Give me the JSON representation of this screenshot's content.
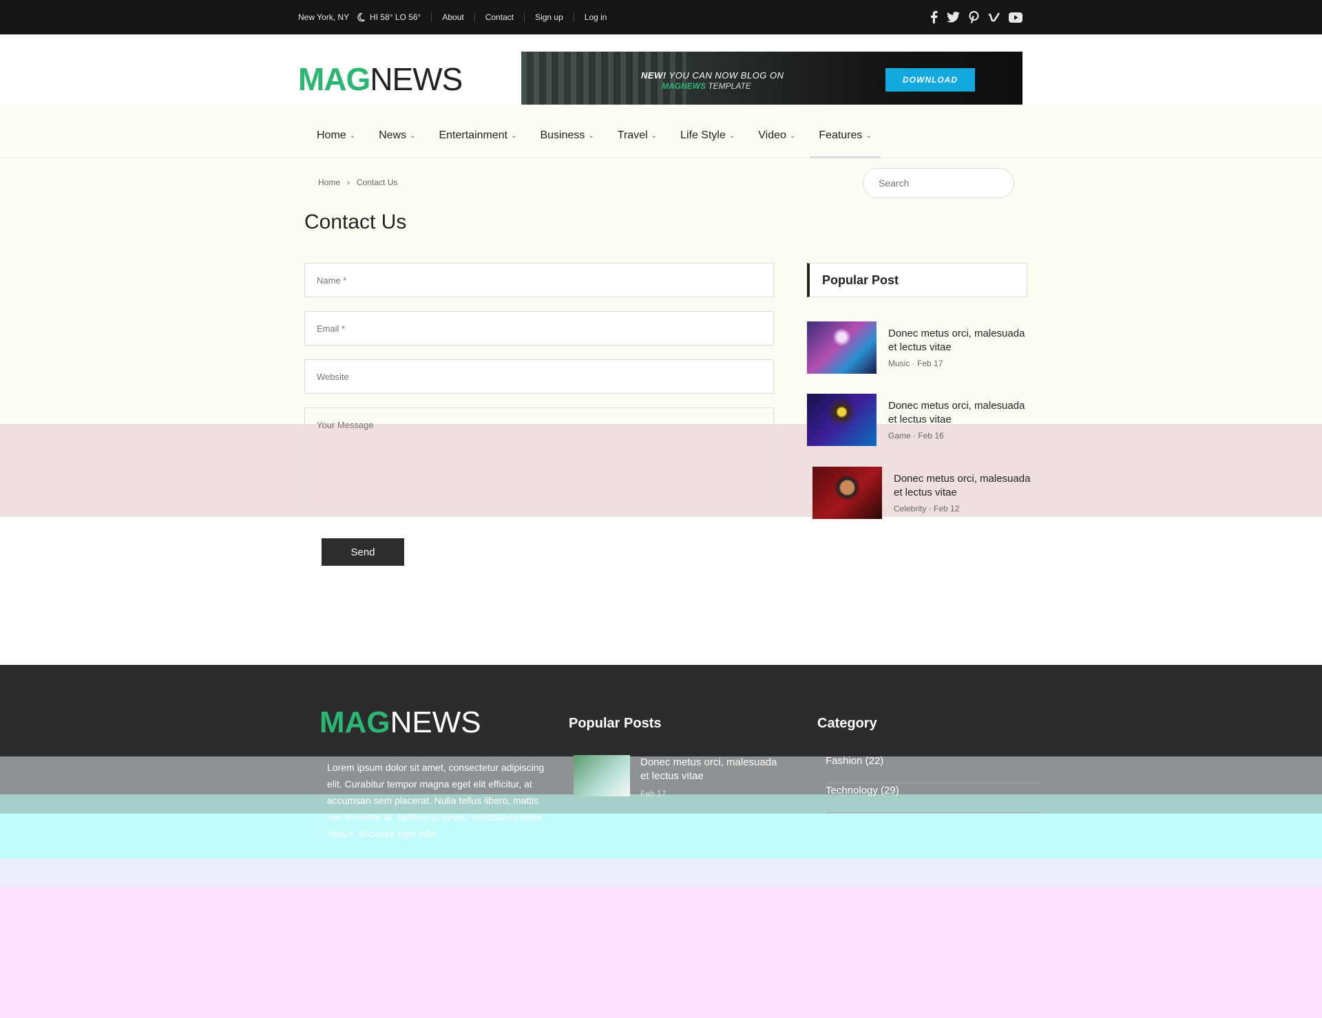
{
  "topbar": {
    "location": "New York, NY",
    "weather": "HI 58° LO 56°",
    "links": [
      "About",
      "Contact",
      "Sign up",
      "Log in"
    ],
    "social_icons": [
      "facebook-icon",
      "twitter-icon",
      "pinterest-icon",
      "vimeo-icon",
      "youtube-icon"
    ]
  },
  "header": {
    "logo_part1": "MAG",
    "logo_part2": "NEWS",
    "banner": {
      "line1_bold": "NEW!",
      "line1": " YOU CAN NOW BLOG ON",
      "line2_brand": "MAGNEWS",
      "line2": " TEMPLATE",
      "button": "DOWNLOAD"
    }
  },
  "nav": {
    "items": [
      {
        "label": "Home"
      },
      {
        "label": "News"
      },
      {
        "label": "Entertainment"
      },
      {
        "label": "Business"
      },
      {
        "label": "Travel"
      },
      {
        "label": "Life Style"
      },
      {
        "label": "Video"
      },
      {
        "label": "Features"
      }
    ]
  },
  "breadcrumb": {
    "home": "Home",
    "sep": "›",
    "current": "Contact Us"
  },
  "search": {
    "placeholder": "Search"
  },
  "page": {
    "title": "Contact Us"
  },
  "form": {
    "name_placeholder": "Name *",
    "email_placeholder": "Email *",
    "website_placeholder": "Website",
    "message_placeholder": "Your Message",
    "send_label": "Send"
  },
  "sidebar": {
    "title": "Popular Post",
    "posts": [
      {
        "title": "Donec metus orci, malesuada et lectus vitae",
        "category": "Music",
        "date": "Feb 17"
      },
      {
        "title": "Donec metus orci, malesuada et lectus vitae",
        "category": "Game",
        "date": "Feb 16"
      },
      {
        "title": "Donec metus orci, malesuada et lectus vitae",
        "category": "Celebrity",
        "date": "Feb 12"
      }
    ]
  },
  "footer": {
    "logo_part1": "MAG",
    "logo_part2": "NEWS",
    "about": "Lorem ipsum dolor sit amet, consectetur adipiscing elit. Curabitur tempor magna eget elit efficitur, at accumsan sem placerat. Nulla tellus libero, mattis nec molestie at, facilisis ut turpis. Vestibulum dolor metus, tincidunt eget odio",
    "popular_title": "Popular Posts",
    "popular_post": {
      "title": "Donec metus orci, malesuada et lectus vitae",
      "date": "Feb 17"
    },
    "category_title": "Category",
    "categories": [
      "Fashion (22)",
      "Technology (29)"
    ]
  },
  "colors": {
    "accent": "#2bb673",
    "dark": "#2c2c2e",
    "banner_button": "#14a9de"
  }
}
